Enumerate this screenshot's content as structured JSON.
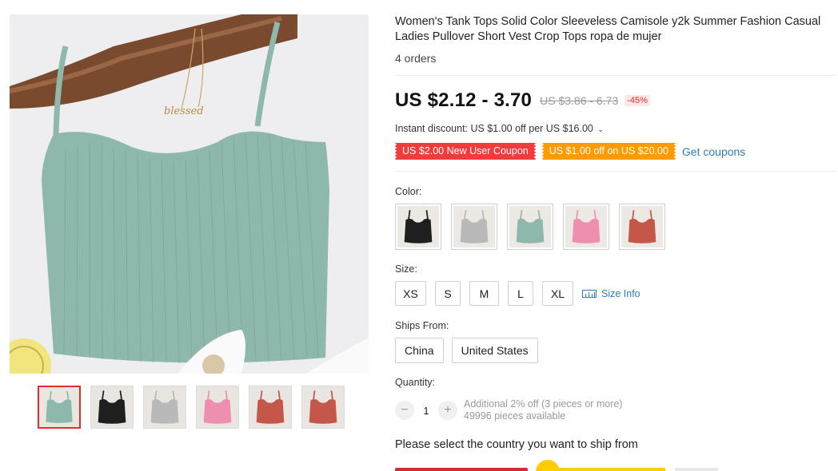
{
  "product": {
    "title": "Women's Tank Tops Solid Color Sleeveless Camisole y2k Summer Fashion Casual Ladies Pullover Short Vest Crop Tops ropa de mujer",
    "orders": "4 orders"
  },
  "pricing": {
    "price": "US $2.12 - 3.70",
    "original_price": "US $3.86 - 6.73",
    "discount": "-45%",
    "instant_discount": "Instant discount: US $1.00 off per US $16.00",
    "chevron_glyph": "⌄"
  },
  "coupons": {
    "new_user": "US $2.00 New User Coupon",
    "store": "US $1.00 off on US $20.00",
    "get_coupons": "Get coupons"
  },
  "colors": {
    "label": "Color:",
    "swatches": [
      {
        "name": "black",
        "hex": "#1f1f1f"
      },
      {
        "name": "gray",
        "hex": "#b9b9b9"
      },
      {
        "name": "sage green",
        "hex": "#8fb8ac"
      },
      {
        "name": "pink",
        "hex": "#ef8fb0"
      },
      {
        "name": "brick red",
        "hex": "#c4574a"
      }
    ]
  },
  "sizes": {
    "label": "Size:",
    "options": [
      "XS",
      "S",
      "M",
      "L",
      "XL"
    ],
    "size_info": "Size Info"
  },
  "ships_from": {
    "label": "Ships From:",
    "options": [
      "China",
      "United States"
    ]
  },
  "quantity": {
    "label": "Quantity:",
    "minus": "−",
    "plus": "+",
    "value": "1",
    "note_line1": "Additional 2% off (3 pieces or more)",
    "note_line2": "49996 pieces available"
  },
  "shipping_prompt": "Please select the country you want to ship from",
  "image": {
    "necklace_text": "blessed",
    "main_color": "#8fb8ac",
    "background_color": "#eeeef0"
  },
  "thumbnails": [
    {
      "name": "green",
      "hex": "#8fb8ac",
      "active": true
    },
    {
      "name": "black",
      "hex": "#1f1f1f",
      "active": false
    },
    {
      "name": "gray",
      "hex": "#b9b9b9",
      "active": false
    },
    {
      "name": "pink",
      "hex": "#ef8fb0",
      "active": false
    },
    {
      "name": "brick red",
      "hex": "#c4574a",
      "active": false
    },
    {
      "name": "brick red closeup",
      "hex": "#c4574a",
      "active": false
    }
  ]
}
